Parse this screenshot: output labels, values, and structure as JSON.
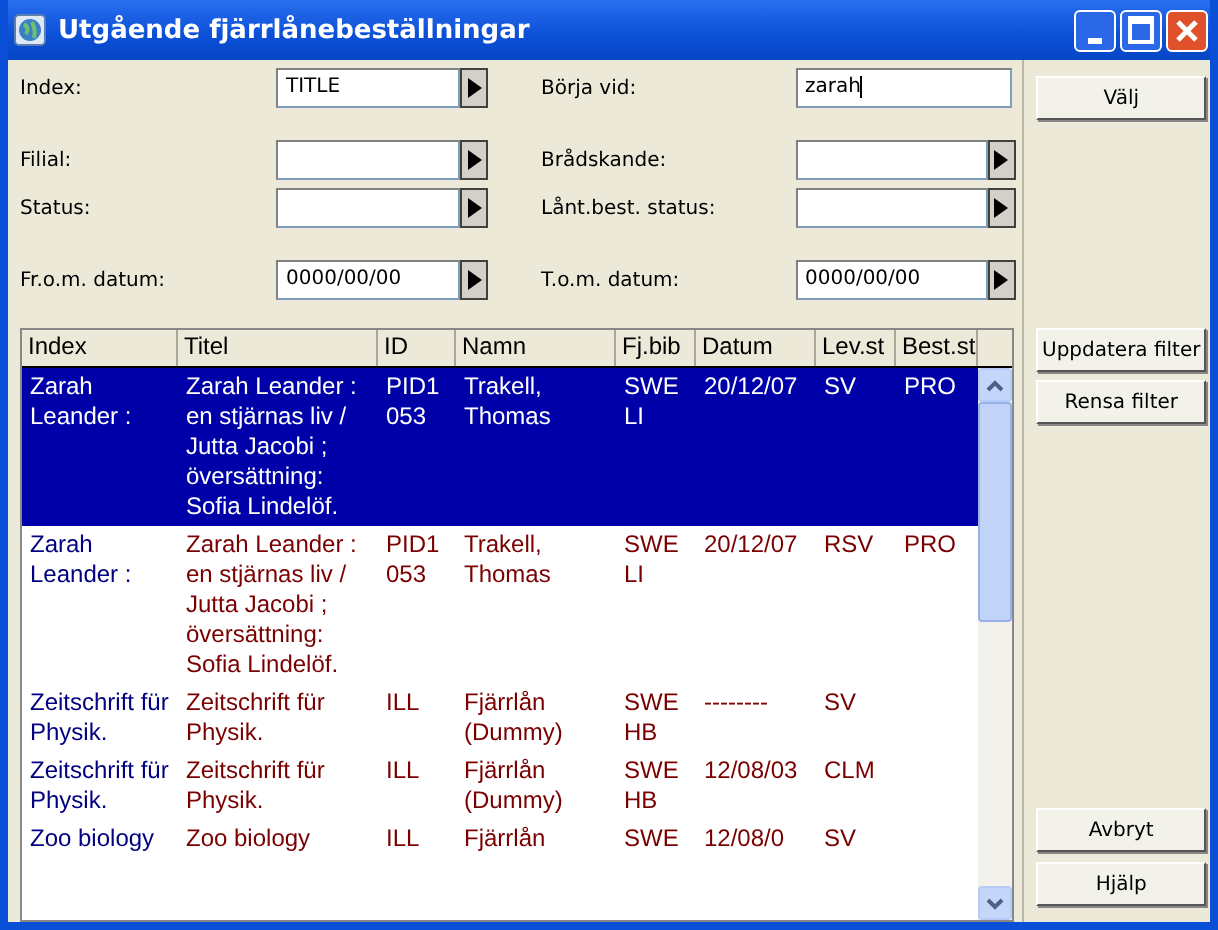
{
  "window": {
    "title": "Utgående fjärrlånebeställningar"
  },
  "filters": [
    {
      "label": "Index:",
      "kind": "dropdown",
      "value": "TITLE"
    },
    {
      "label": "Börja vid:",
      "kind": "text",
      "value": "zarah",
      "focused": true
    },
    {
      "label": "Filial:",
      "kind": "dropdown"
    },
    {
      "label": "Brådskande:",
      "kind": "dropdown"
    },
    {
      "label": "Status:",
      "kind": "dropdown"
    },
    {
      "label": "Lånt.best. status:",
      "kind": "dropdown"
    },
    {
      "label": "Fr.o.m. datum:",
      "kind": "dropdown",
      "value": "0000/00/00"
    },
    {
      "label": "T.o.m. datum:",
      "kind": "dropdown",
      "value": "0000/00/00"
    }
  ],
  "table": {
    "columns": [
      "Index",
      "Titel",
      "ID",
      "Namn",
      "Fj.bib",
      "Datum",
      "Lev.st",
      "Best.st"
    ],
    "rows": [
      {
        "selected": true,
        "cells": [
          "Zarah Leander :",
          "Zarah Leander : en stjärnas liv / Jutta Jacobi ; översättning: Sofia Lindelöf.",
          "PID1053",
          "Trakell, Thomas",
          "SWELI",
          "20/12/07",
          "SV",
          "PRO"
        ]
      },
      {
        "selected": false,
        "cells": [
          "Zarah Leander :",
          "Zarah Leander : en stjärnas liv / Jutta Jacobi ; översättning: Sofia Lindelöf.",
          "PID1053",
          "Trakell, Thomas",
          "SWELI",
          "20/12/07",
          "RSV",
          "PRO"
        ]
      },
      {
        "selected": false,
        "cells": [
          "Zeitschrift für Physik.",
          "Zeitschrift für Physik.",
          "ILL",
          "Fjärrlån (Dummy)",
          "SWEHB",
          "--------",
          "SV",
          null
        ]
      },
      {
        "selected": false,
        "cells": [
          "Zeitschrift für Physik.",
          "Zeitschrift für Physik.",
          "ILL",
          "Fjärrlån (Dummy)",
          "SWEHB",
          "12/08/03",
          "CLM",
          null
        ]
      },
      {
        "selected": false,
        "cells": [
          "Zoo biology",
          "Zoo biology",
          "ILL",
          "Fjärrlån",
          "SWE",
          "12/08/0",
          "SV",
          null
        ]
      }
    ]
  },
  "buttons_top": [
    "Välj"
  ],
  "buttons_filter": [
    "Uppdatera filter",
    "Rensa filter"
  ],
  "buttons_bottom": [
    "Avbryt",
    "Hjälp"
  ]
}
